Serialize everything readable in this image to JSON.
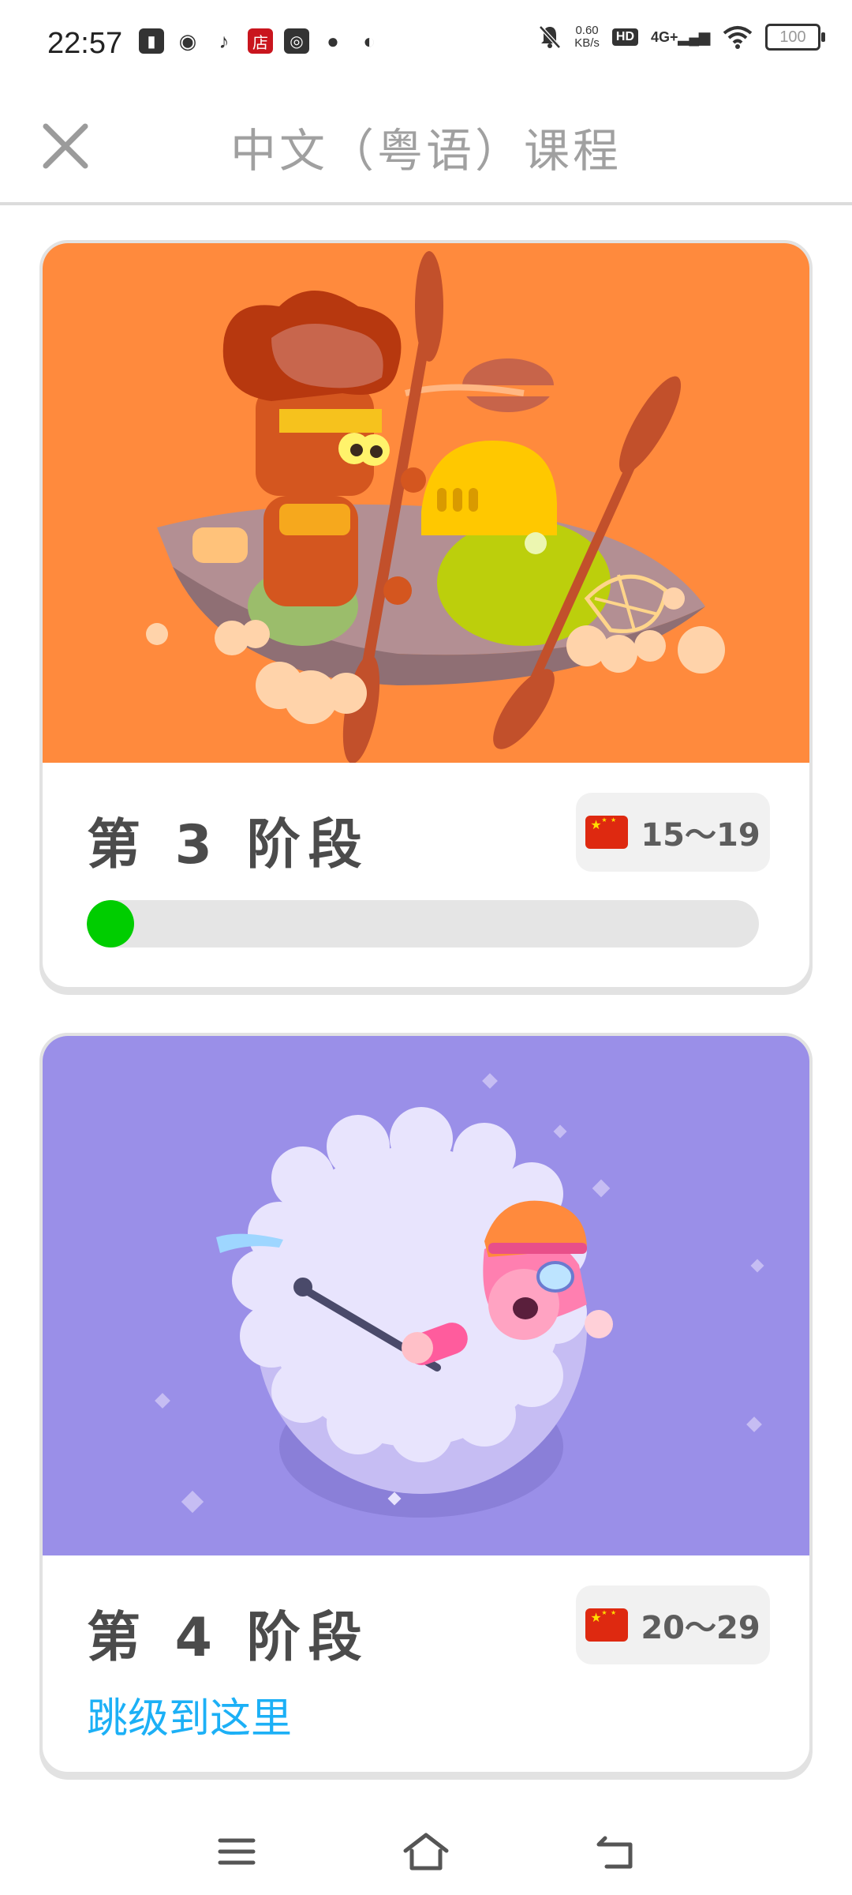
{
  "status_bar": {
    "time": "22:57",
    "net_speed_value": "0.60",
    "net_speed_unit": "KB/s",
    "hd_label": "HD",
    "signal_label": "4G+",
    "battery_level": "100",
    "left_icons": [
      "sim-icon",
      "weibo-icon",
      "tiktok-icon",
      "shop-icon",
      "dewu-icon",
      "qq-icon",
      "chat-icon"
    ],
    "shop_icon_glyph": "店"
  },
  "header": {
    "title": "中文（粤语）课程"
  },
  "stages": [
    {
      "title": "第 3 阶段",
      "age_range": "15～19",
      "progress_fraction": 0.02,
      "background": "#ff8a3d"
    },
    {
      "title": "第 4 阶段",
      "age_range": "20～29",
      "jump_link": "跳级到这里",
      "background": "#9a8fe8"
    }
  ]
}
